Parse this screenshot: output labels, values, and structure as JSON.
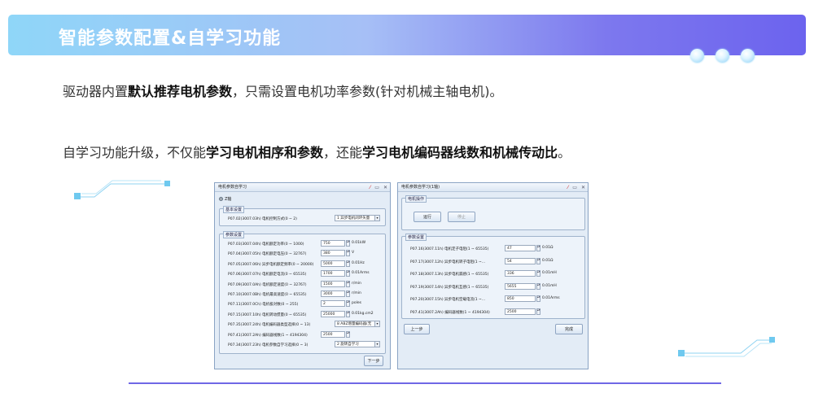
{
  "banner": {
    "title": "智能参数配置&自学习功能"
  },
  "line1": {
    "pre": "驱动器内置",
    "hl": "默认推荐电机参数",
    "post": "，只需设置电机功率参数(针对机械主轴电机)。"
  },
  "line2": {
    "pre": "自学习功能升级，不仅能",
    "hl1": "学习电机相序和参数",
    "mid": "，还能",
    "hl2": "学习电机编码器线数和机械传动比",
    "post": "。"
  },
  "win1": {
    "title": "电机参数自学习",
    "radio_label": "Z轴",
    "basic_group": "基本设置",
    "basic_row": {
      "label": "P07.02(3007.03h) 电机控制方式(0 ~ 2)",
      "value": "1 异步电机闭环矢量"
    },
    "param_group": "参数设置",
    "rows": [
      {
        "label": "P07.03(3007.04h) 电机额定功率(0 ~ 1000)",
        "value": "750",
        "unit": "0.01kW"
      },
      {
        "label": "P07.04(3007.05h) 电机额定电压(0 ~ 32767)",
        "value": "380",
        "unit": "V"
      },
      {
        "label": "P07.05(3007.06h) 异步电机额定频率(0 ~ 20000)",
        "value": "5000",
        "unit": "0.01Hz"
      },
      {
        "label": "P07.06(3007.07h) 电机额定电流(0 ~ 65535)",
        "value": "1700",
        "unit": "0.01Arms"
      },
      {
        "label": "P07.09(3007.0Ah) 电机额定速度(0 ~ 32767)",
        "value": "1500",
        "unit": "r/min"
      },
      {
        "label": "P07.10(3007.0Bh) 电机最高速度(0 ~ 65535)",
        "value": "3000",
        "unit": "r/min"
      },
      {
        "label": "P07.11(3007.0Ch) 电机极对数(0 ~ 255)",
        "value": "2",
        "unit": "poles"
      },
      {
        "label": "P07.15(3007.10h) 电机转动惯量(0 ~ 65535)",
        "value": "25000",
        "unit": "0.01kg.cm2"
      }
    ],
    "encoder_row": {
      "label": "P07.35(3007.24h) 电机编码器类型选择(0 ~ 13)",
      "value": "8 ABZ增量编码器(无"
    },
    "lines_row": {
      "label": "P07.41(3007.2Ah) 编码器线数(1 ~ 4194304)",
      "value": "2500"
    },
    "mode_row": {
      "label": "P07.34(3007.23h) 电机参数自学习选择(0 ~ 3)",
      "value": "2 旋转自学习"
    },
    "next_button": "下一步"
  },
  "win2": {
    "title": "电机参数自学习(1轴)",
    "op_group": "电机操作",
    "run_button": "运行",
    "stop_button": "停止",
    "param_group": "参数设置",
    "rows": [
      {
        "label": "P07.16(3007.11h) 电机定子电阻(1 ~ 65535)",
        "value": "47",
        "unit": "0.01Ω"
      },
      {
        "label": "P07.17(3007.12h) 异步电机转子电阻(1 ~...",
        "value": "54",
        "unit": "0.01Ω"
      },
      {
        "label": "P07.18(3007.13h) 异步电机漏感(1 ~ 65535)",
        "value": "336",
        "unit": "0.01mH"
      },
      {
        "label": "P07.19(3007.14h) 异步电机互感(1 ~ 65535)",
        "value": "5655",
        "unit": "0.01mH"
      },
      {
        "label": "P07.20(3007.15h) 异步电机空载电流(1 ~...",
        "value": "850",
        "unit": "0.01Arms"
      },
      {
        "label": "P07.41(3007.2Ah) 编码器线数(1 ~ 4194304)",
        "value": "2500",
        "unit": ""
      }
    ],
    "prev_button": "上一步",
    "finish_button": "完成"
  }
}
